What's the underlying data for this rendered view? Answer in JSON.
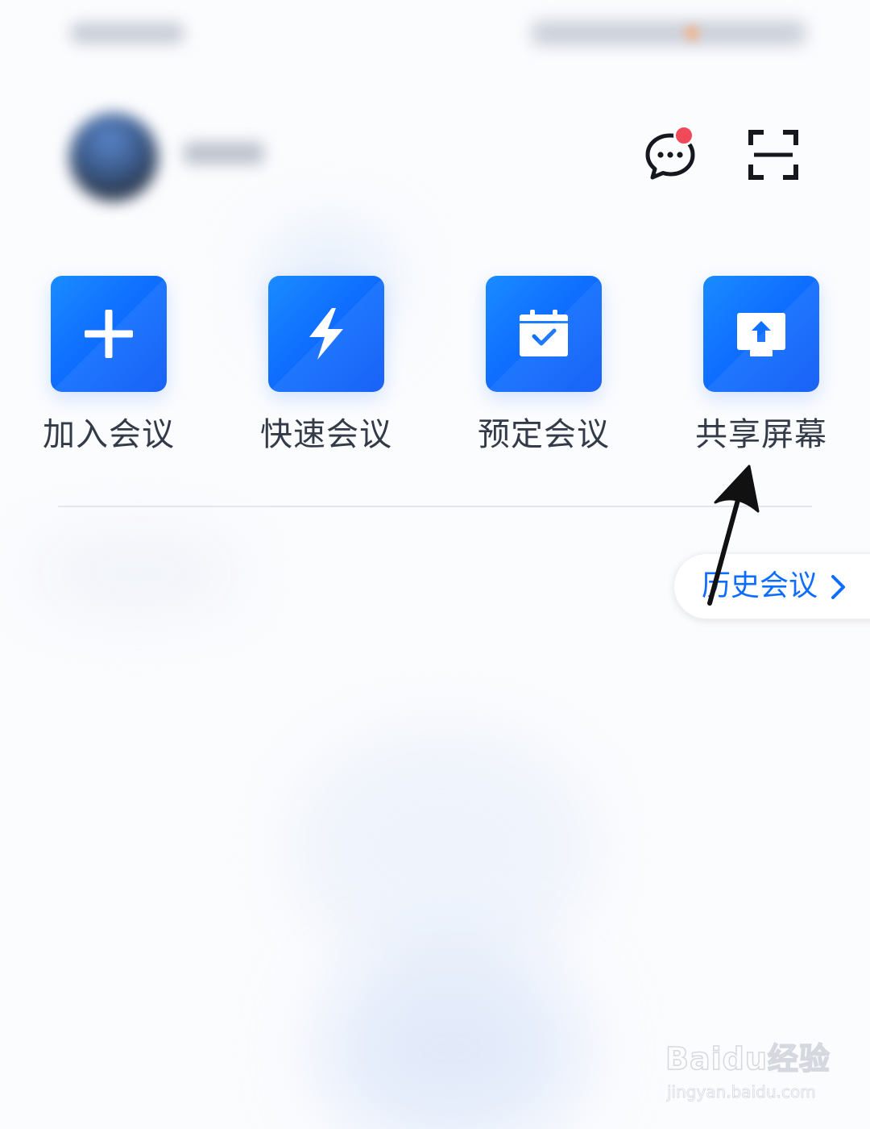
{
  "header": {
    "message_icon": "chat-bubble-icon",
    "scan_icon": "scan-icon",
    "notification_color": "#f0495a"
  },
  "actions": [
    {
      "label": "加入会议",
      "icon": "plus-icon"
    },
    {
      "label": "快速会议",
      "icon": "lightning-icon"
    },
    {
      "label": "预定会议",
      "icon": "calendar-check-icon"
    },
    {
      "label": "共享屏幕",
      "icon": "share-screen-icon"
    }
  ],
  "history": {
    "label": "历史会议",
    "icon": "chevron-right-icon"
  },
  "colors": {
    "accent": "#0e6dff",
    "tile_gradient_start": "#1a8cff",
    "tile_gradient_end": "#0856f5",
    "text": "#333a48"
  },
  "watermark": {
    "main": "Baidu经验",
    "sub": "jingyan.baidu.com"
  }
}
